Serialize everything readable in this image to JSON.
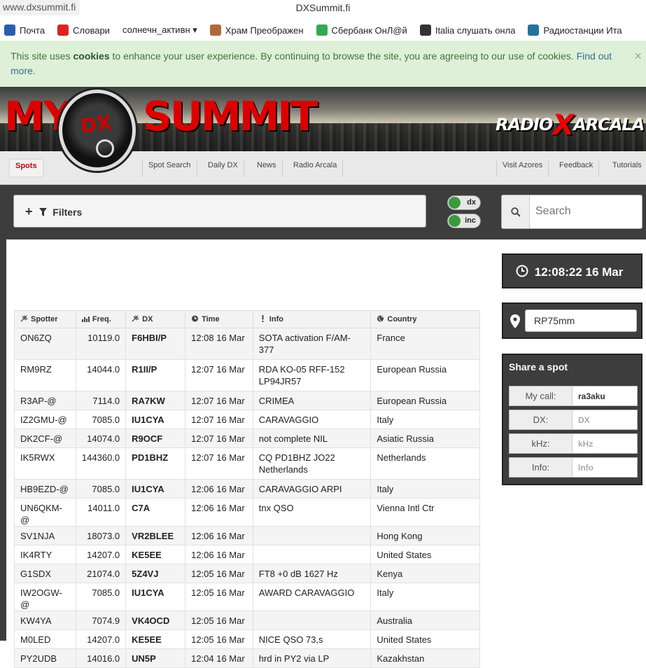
{
  "browser": {
    "url": "www.dxsummit.fi",
    "title": "DXSummit.fi",
    "bookmarks": [
      {
        "label": "Почта",
        "icon": "mail-icon",
        "color": "#2a5db0"
      },
      {
        "label": "Словари",
        "icon": "dictionary-icon",
        "color": "#d22"
      },
      {
        "label": "солнечн_активн ▾",
        "icon": "folder-icon",
        "color": "#ffffff"
      },
      {
        "label": "Храм Преображен",
        "icon": "church-icon",
        "color": "#b06a3a"
      },
      {
        "label": "Сбербанк ОнЛ@й",
        "icon": "google-icon",
        "color": "#34a853"
      },
      {
        "label": "Italia слушать онла",
        "icon": "play-icon",
        "color": "#333333"
      },
      {
        "label": "Радиостанции Ита",
        "icon": "wordpress-icon",
        "color": "#21759b"
      }
    ]
  },
  "cookie": {
    "pre": "This site uses ",
    "strong": "cookies",
    "mid": " to enhance your user experience. By continuing to browse the site, you are agreeing to our use of cookies. ",
    "link": "Find out more.",
    "close": "×"
  },
  "banner": {
    "my": "MY",
    "dx": "DX",
    "summit": "SUMMIT",
    "radio": "RADIO",
    "x": "X",
    "arcala": "ARCALA"
  },
  "nav": {
    "spots": "Spots",
    "spot_search": "Spot Search",
    "daily_dx": "Daily DX",
    "news": "News",
    "radio_arcala": "Radio Arcala",
    "visit_azores": "Visit Azores",
    "feedback": "Feedback",
    "tutorials": "Tutorials"
  },
  "filters": {
    "plus": "+",
    "label": "Filters"
  },
  "toggles": {
    "dx": "dx",
    "inc": "inc"
  },
  "search": {
    "placeholder": "Search"
  },
  "table": {
    "headers": {
      "spotter": "Spotter",
      "freq": "Freq.",
      "dx": "DX",
      "time": "Time",
      "info": "Info",
      "country": "Country"
    },
    "rows": [
      {
        "spotter": "ON6ZQ",
        "freq": "10119.0",
        "dx": "F6HBI/P",
        "time": "12:08 16 Mar",
        "info": "SOTA activation F/AM-377",
        "country": "France"
      },
      {
        "spotter": "RM9RZ",
        "freq": "14044.0",
        "dx": "R1II/P",
        "time": "12:07 16 Mar",
        "info": "RDA KO-05 RFF-152 LP94JR57",
        "country": "European Russia"
      },
      {
        "spotter": "R3AP-@",
        "freq": "7114.0",
        "dx": "RA7KW",
        "time": "12:07 16 Mar",
        "info": "CRIMEA",
        "country": "European Russia"
      },
      {
        "spotter": "IZ2GMU-@",
        "freq": "7085.0",
        "dx": "IU1CYA",
        "time": "12:07 16 Mar",
        "info": "CARAVAGGIO",
        "country": "Italy"
      },
      {
        "spotter": "DK2CF-@",
        "freq": "14074.0",
        "dx": "R9OCF",
        "time": "12:07 16 Mar",
        "info": "not complete NIL",
        "country": "Asiatic Russia"
      },
      {
        "spotter": "IK5RWX",
        "freq": "144360.0",
        "dx": "PD1BHZ",
        "time": "12:07 16 Mar",
        "info": "CQ PD1BHZ JO22 Netherlands",
        "country": "Netherlands"
      },
      {
        "spotter": "HB9EZD-@",
        "freq": "7085.0",
        "dx": "IU1CYA",
        "time": "12:06 16 Mar",
        "info": "CARAVAGGIO ARPI",
        "country": "Italy"
      },
      {
        "spotter": "UN6QKM-@",
        "freq": "14011.0",
        "dx": "C7A",
        "time": "12:06 16 Mar",
        "info": "tnx QSO",
        "country": "Vienna Intl Ctr"
      },
      {
        "spotter": "SV1NJA",
        "freq": "18073.0",
        "dx": "VR2BLEE",
        "time": "12:06 16 Mar",
        "info": "",
        "country": "Hong Kong"
      },
      {
        "spotter": "IK4RTY",
        "freq": "14207.0",
        "dx": "KE5EE",
        "time": "12:06 16 Mar",
        "info": "",
        "country": "United States"
      },
      {
        "spotter": "G1SDX",
        "freq": "21074.0",
        "dx": "5Z4VJ",
        "time": "12:05 16 Mar",
        "info": "FT8 +0 dB 1627 Hz",
        "country": "Kenya"
      },
      {
        "spotter": "IW2OGW-@",
        "freq": "7085.0",
        "dx": "IU1CYA",
        "time": "12:05 16 Mar",
        "info": "AWARD CARAVAGGIO",
        "country": "Italy"
      },
      {
        "spotter": "KW4YA",
        "freq": "7074.9",
        "dx": "VK4OCD",
        "time": "12:05 16 Mar",
        "info": "",
        "country": "Australia"
      },
      {
        "spotter": "M0LED",
        "freq": "14207.0",
        "dx": "KE5EE",
        "time": "12:05 16 Mar",
        "info": "NICE QSO 73,s",
        "country": "United States"
      },
      {
        "spotter": "PY2UDB",
        "freq": "14016.0",
        "dx": "UN5P",
        "time": "12:04 16 Mar",
        "info": "hrd in PY2 via LP",
        "country": "Kazakhstan"
      }
    ]
  },
  "clock": {
    "text": "12:08:22 16 Mar"
  },
  "locator": {
    "value": "RP75mm"
  },
  "share": {
    "title": "Share a spot",
    "mycall_label": "My call:",
    "mycall_value": "ra3aku",
    "dx_label": "DX:",
    "dx_placeholder": "DX",
    "khz_label": "kHz:",
    "khz_placeholder": "kHz",
    "info_label": "Info:",
    "info_placeholder": "Info"
  }
}
